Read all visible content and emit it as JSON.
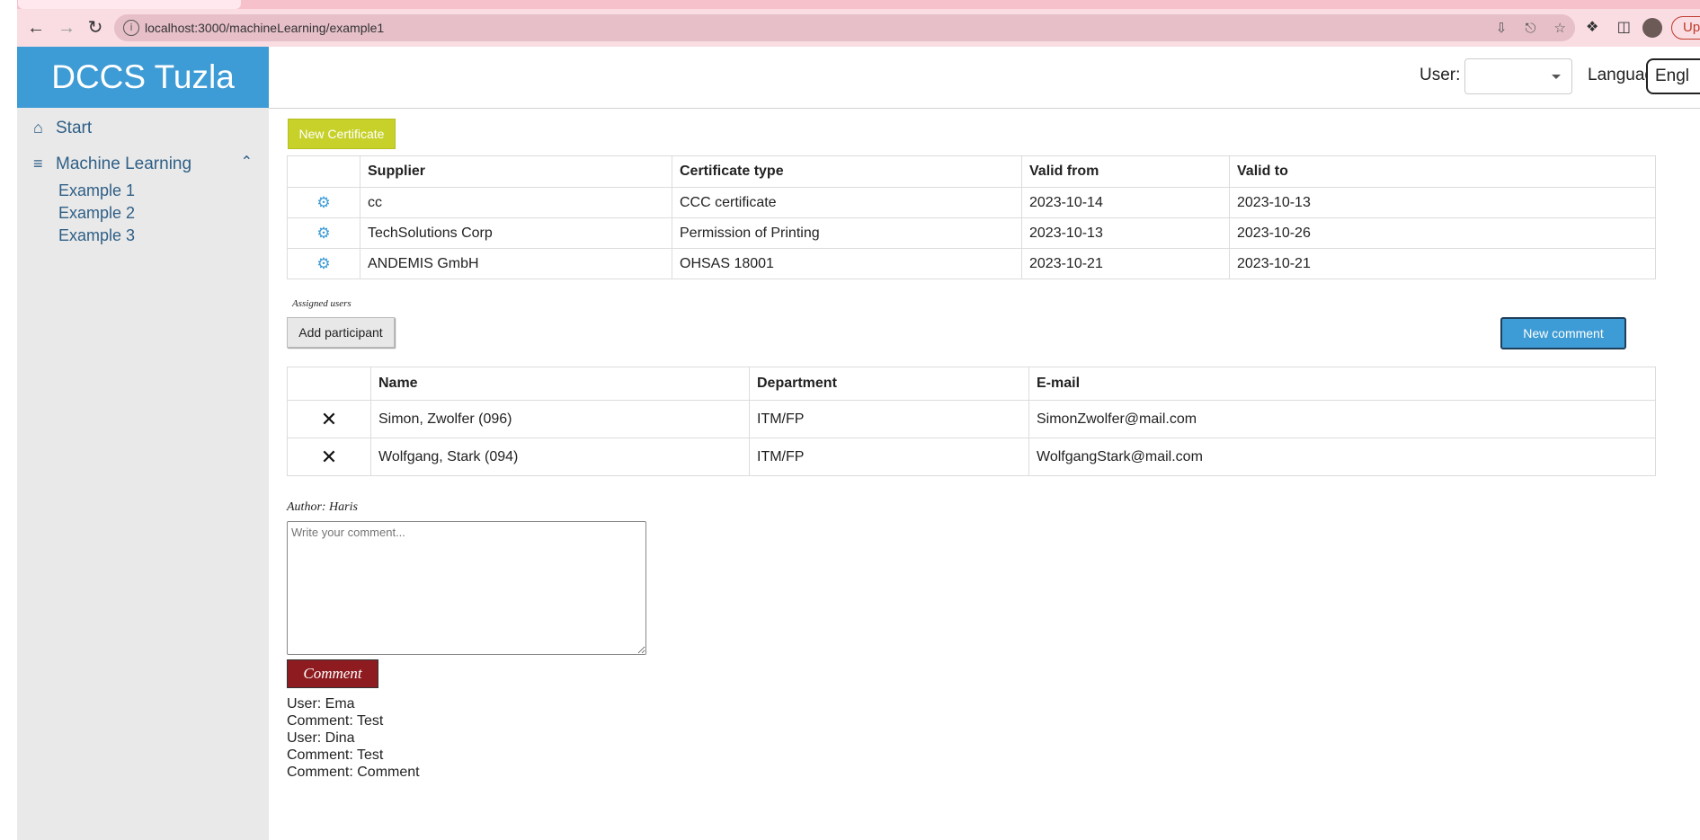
{
  "browser": {
    "url": "localhost:3000/machineLearning/example1",
    "update_label": "Updat"
  },
  "sidebar": {
    "brand": "DCCS Tuzla",
    "start": "Start",
    "section": "Machine Learning",
    "items": [
      {
        "label": "Example 1"
      },
      {
        "label": "Example 2"
      },
      {
        "label": "Example 3"
      }
    ]
  },
  "header": {
    "user_label": "User:",
    "user_value": "",
    "language_label": "Language:",
    "language_value": "Engl"
  },
  "certificates": {
    "new_button": "New Certificate",
    "columns": [
      "Supplier",
      "Certificate type",
      "Valid from",
      "Valid to"
    ],
    "rows": [
      {
        "supplier": "cc",
        "type": "CCC certificate",
        "from": "2023-10-14",
        "to": "2023-10-13"
      },
      {
        "supplier": "TechSolutions Corp",
        "type": "Permission of Printing",
        "from": "2023-10-13",
        "to": "2023-10-26"
      },
      {
        "supplier": "ANDEMIS GmbH",
        "type": "OHSAS 18001",
        "from": "2023-10-21",
        "to": "2023-10-21"
      }
    ]
  },
  "participants": {
    "assigned_label": "Assigned users",
    "add_button": "Add participant",
    "new_comment_button": "New comment",
    "columns": [
      "Name",
      "Department",
      "E-mail"
    ],
    "rows": [
      {
        "name": "Simon, Zwolfer (096)",
        "department": "ITM/FP",
        "email": "SimonZwolfer@mail.com"
      },
      {
        "name": "Wolfgang, Stark (094)",
        "department": "ITM/FP",
        "email": "WolfgangStark@mail.com"
      }
    ]
  },
  "comment_form": {
    "author": "Author: Haris",
    "placeholder": "Write your comment...",
    "submit": "Comment"
  },
  "comments": [
    "User: Ema",
    "Comment: Test",
    "User: Dina",
    "Comment: Test",
    "Comment: Comment"
  ],
  "colors": {
    "brand": "#3d9bd5",
    "new_certificate": "#c7d12a",
    "comment_button": "#8e1b1f"
  }
}
